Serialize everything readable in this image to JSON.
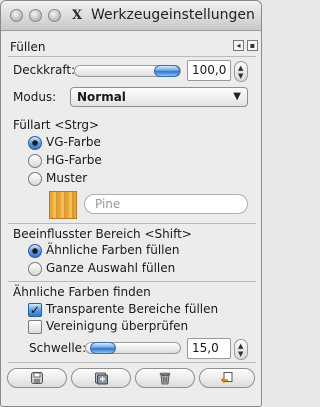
{
  "window": {
    "title": "Werkzeugeinstellungen"
  },
  "panel": {
    "title": "Füllen"
  },
  "opacity": {
    "label": "Deckkraft:",
    "value": "100,0",
    "level_percent": 100
  },
  "mode": {
    "label": "Modus:",
    "value": "Normal"
  },
  "fill_type": {
    "heading": "Füllart  <Strg>",
    "options": [
      "VG-Farbe",
      "HG-Farbe",
      "Muster"
    ],
    "selected": "VG-Farbe",
    "pattern_name": "Pine"
  },
  "affected_area": {
    "heading": "Beeinflusster Bereich  <Shift>",
    "options": [
      "Ähnliche Farben füllen",
      "Ganze Auswahl füllen"
    ],
    "selected": "Ähnliche Farben füllen"
  },
  "find_similar": {
    "heading": "Ähnliche Farben finden",
    "checkboxes": [
      {
        "label": "Transparente Bereiche füllen",
        "checked": true
      },
      {
        "label": "Vereinigung überprüfen",
        "checked": false
      }
    ],
    "threshold_label": "Schwelle:",
    "threshold_value": "15,0",
    "threshold_level_percent": 6
  },
  "icons": {
    "save": "save-icon",
    "restore": "restore-icon",
    "delete": "delete-icon",
    "reset": "reset-icon"
  },
  "colors": {
    "accent": "#3a7fd4",
    "window_bg": "#ececec"
  }
}
